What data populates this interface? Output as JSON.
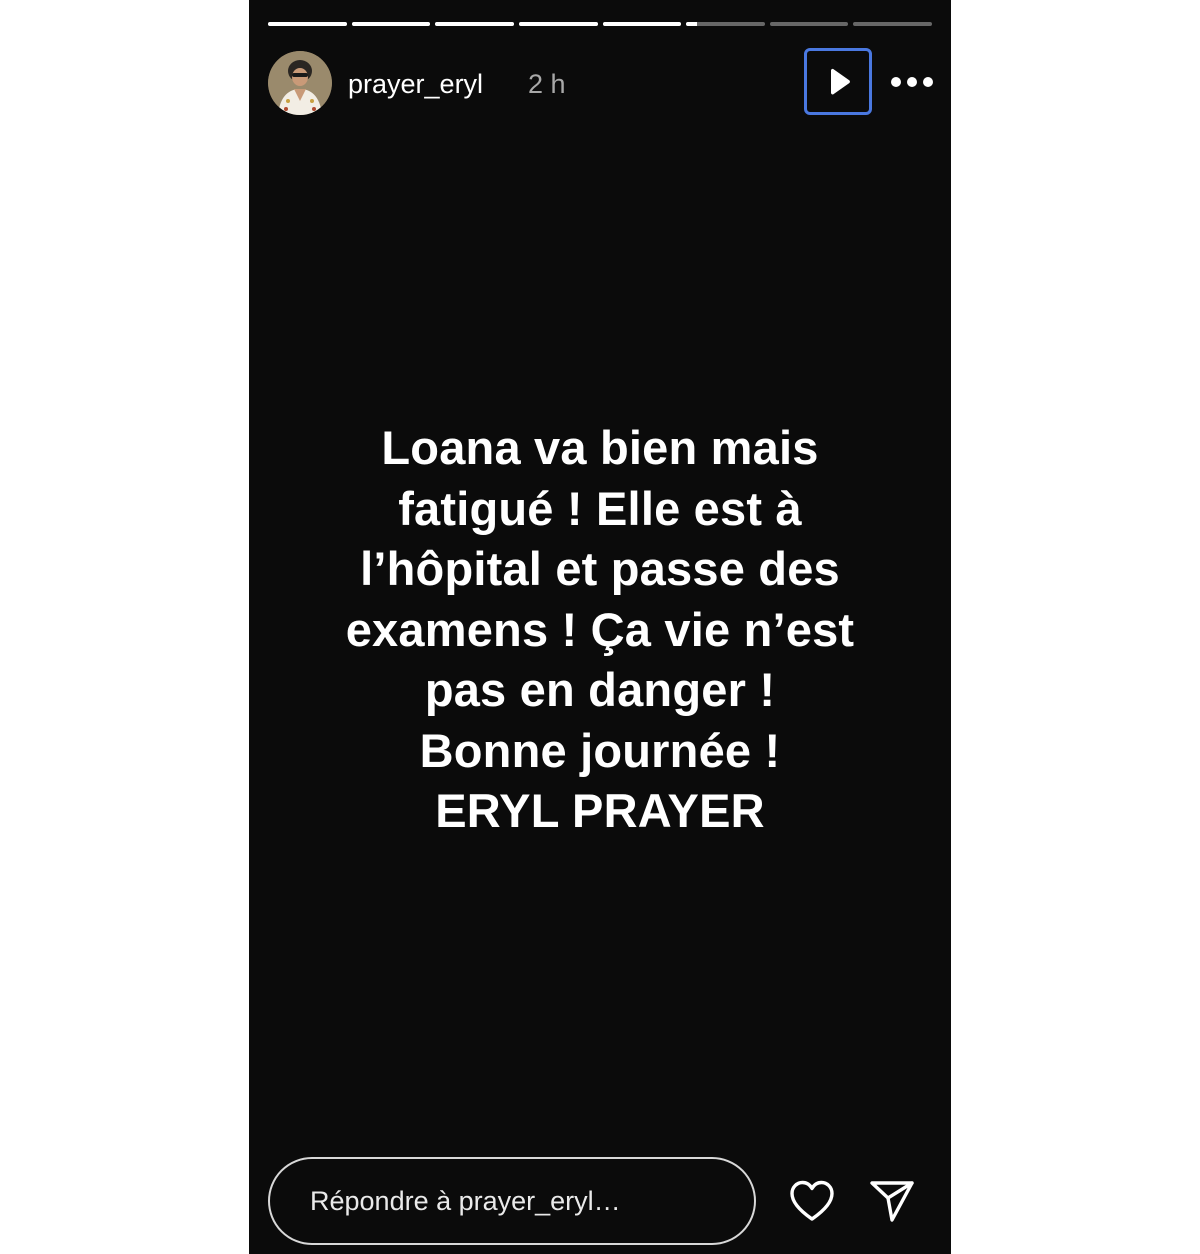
{
  "story": {
    "progress": [
      1,
      1,
      1,
      1,
      1,
      0.14,
      0,
      0
    ],
    "background": "#0b0b0b"
  },
  "header": {
    "username": "prayer_eryl",
    "time_ago": "2 h",
    "avatar_icon": "profile-avatar",
    "play_icon": "play-icon",
    "more_icon": "more-horizontal-icon",
    "focus_color": "#4a78e0"
  },
  "message": {
    "lines": [
      "Loana va bien mais",
      "fatigué ! Elle est à",
      "l’hôpital et passe des",
      "examens ! Ça vie n’est",
      "pas en danger !",
      "Bonne journée !",
      "ERYL PRAYER"
    ]
  },
  "footer": {
    "reply_placeholder": "Répondre à prayer_eryl…",
    "like_icon": "heart-icon",
    "share_icon": "send-icon"
  }
}
